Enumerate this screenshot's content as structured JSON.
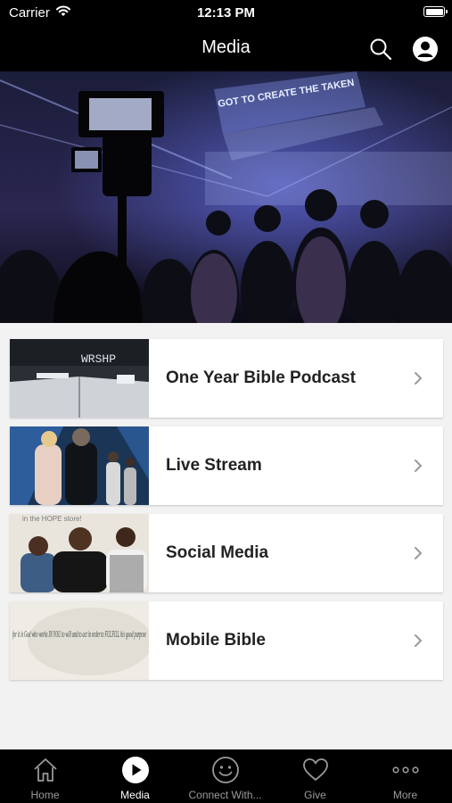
{
  "status_bar": {
    "carrier": "Carrier",
    "time": "12:13 PM"
  },
  "header": {
    "title": "Media"
  },
  "hero": {
    "banner_text": "GOT TO CREATE THE TAKEN"
  },
  "media_items": [
    {
      "label": "One Year Bible Podcast",
      "thumb_text": "WRSHP"
    },
    {
      "label": "Live Stream"
    },
    {
      "label": "Social Media",
      "thumb_text": "in the HOPE store!"
    },
    {
      "label": "Mobile Bible",
      "thumb_text": "for it is God who works IN YOU to will and to act in order to FULFILL his good purpose"
    }
  ],
  "tabs": [
    {
      "label": "Home",
      "icon": "home-icon"
    },
    {
      "label": "Media",
      "icon": "play-icon",
      "active": true
    },
    {
      "label": "Connect With...",
      "icon": "smiley-icon"
    },
    {
      "label": "Give",
      "icon": "heart-icon"
    },
    {
      "label": "More",
      "icon": "more-icon"
    }
  ],
  "colors": {
    "bar_background": "#000000",
    "page_background": "#f2f2f2",
    "card_background": "#ffffff",
    "inactive_tab": "#9a9a9a",
    "active_tab": "#ffffff"
  }
}
